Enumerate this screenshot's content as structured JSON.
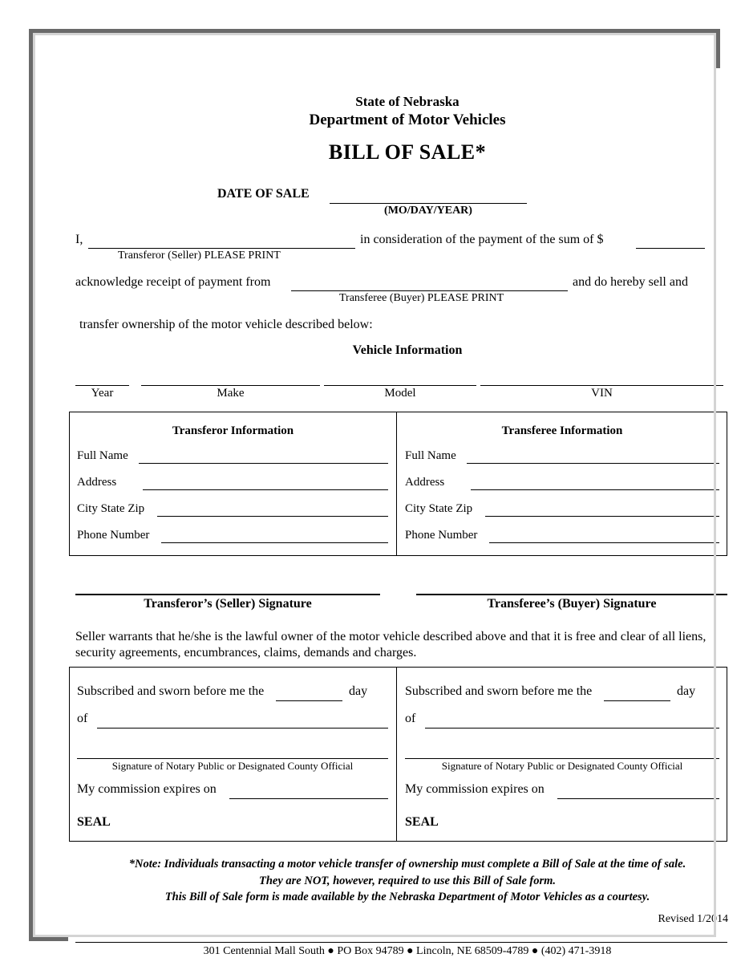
{
  "document": {
    "agency_line1": "State of Nebraska",
    "agency_line2": "Department of Motor Vehicles",
    "title": "BILL OF SALE*"
  },
  "date_of_sale": {
    "label": "DATE OF SALE",
    "format_hint": "(MO/DAY/YEAR)",
    "value": ""
  },
  "consideration": {
    "i_label": "I,",
    "seller_caption": "Transferor (Seller) PLEASE PRINT",
    "seller_value": "",
    "middle_text": "in consideration of the payment of the sum of $",
    "amount_value": "",
    "acknowledge_text": "acknowledge receipt of payment from",
    "buyer_caption": "Transferee (Buyer) PLEASE PRINT",
    "buyer_value": "",
    "tail_text": "and do hereby sell and",
    "transfer_text": "transfer ownership of the motor vehicle described below:"
  },
  "vehicle": {
    "section_title": "Vehicle Information",
    "fields": [
      {
        "label": "Year",
        "value": ""
      },
      {
        "label": "Make",
        "value": ""
      },
      {
        "label": "Model",
        "value": ""
      },
      {
        "label": "VIN",
        "value": ""
      }
    ]
  },
  "parties": {
    "transferor": {
      "panel_title": "Transferor Information",
      "fields": [
        {
          "label": "Full Name",
          "value": ""
        },
        {
          "label": "Address",
          "value": ""
        },
        {
          "label": "City State Zip",
          "value": ""
        },
        {
          "label": "Phone Number",
          "value": ""
        }
      ]
    },
    "transferee": {
      "panel_title": "Transferee Information",
      "fields": [
        {
          "label": "Full Name",
          "value": ""
        },
        {
          "label": "Address",
          "value": ""
        },
        {
          "label": "City State Zip",
          "value": ""
        },
        {
          "label": "Phone Number",
          "value": ""
        }
      ]
    }
  },
  "signatures": {
    "seller_caption": "Transferor’s (Seller) Signature",
    "buyer_caption": "Transferee’s (Buyer) Signature",
    "seller_value": "",
    "buyer_value": ""
  },
  "warranty_text": "Seller warrants that he/she is the lawful owner of the motor vehicle described above and that it is free and clear of all liens, security agreements, encumbrances, claims, demands and charges.",
  "notary": {
    "sworn_prefix": "Subscribed and sworn before me the",
    "day_word": "day",
    "of_word": "of",
    "signature_caption": "Signature of Notary Public or Designated County Official",
    "commission_label": "My commission expires on",
    "seal_label": "SEAL",
    "left": {
      "day_value": "",
      "month_year_value": "",
      "commission_value": ""
    },
    "right": {
      "day_value": "",
      "month_year_value": "",
      "commission_value": ""
    }
  },
  "note": {
    "line1": "*Note:  Individuals transacting a motor vehicle transfer of ownership must complete a Bill of Sale at the time of sale.",
    "line2": "They are NOT, however, required to use this Bill of Sale form.",
    "line3": "This Bill of Sale form is made available by the Nebraska Department of Motor Vehicles as a courtesy."
  },
  "revised": "Revised 1/2014",
  "footer": "301 Centennial Mall South ● PO Box 94789 ● Lincoln, NE 68509-4789 ● (402) 471-3918"
}
